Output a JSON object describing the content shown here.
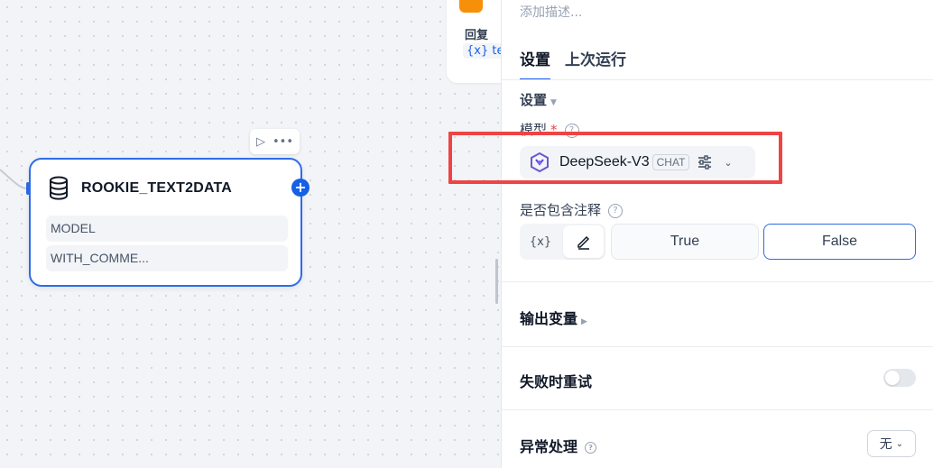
{
  "canvas": {
    "top_node": {
      "reply_label": "回复",
      "var_text": "{x} te"
    },
    "node": {
      "title": "ROOKIE_TEXT2DATA",
      "fields": [
        "MODEL",
        "WITH_COMME..."
      ],
      "icon": "database-stack-icon"
    }
  },
  "panel": {
    "description_placeholder": "添加描述...",
    "tabs": [
      {
        "label": "设置",
        "active": true
      },
      {
        "label": "上次运行",
        "active": false
      }
    ],
    "section_label": "设置",
    "model": {
      "label": "模型",
      "required_mark": "*",
      "name": "DeepSeek-V3",
      "badge": "CHAT"
    },
    "include_comments": {
      "label": "是否包含注释",
      "var_toggle": "{x}",
      "options": [
        "True",
        "False"
      ],
      "selected": "False"
    },
    "output_vars_label": "输出变量",
    "retry_on_fail_label": "失败时重试",
    "retry_enabled": false,
    "error_handling": {
      "label": "异常处理",
      "value": "无"
    }
  },
  "colors": {
    "accent": "#155eef",
    "highlight": "#ee4444",
    "node_border": "#2e6ce6"
  }
}
